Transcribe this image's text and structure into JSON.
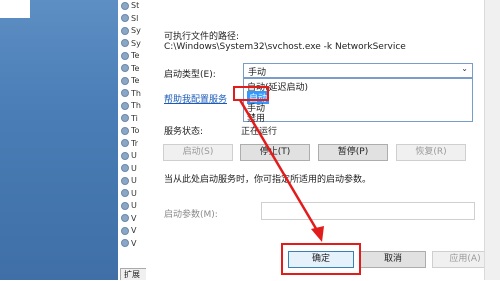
{
  "services_list": {
    "items": [
      "St",
      "Sl",
      "Sy",
      "Sy",
      "Te",
      "Te",
      "Te",
      "Th",
      "Th",
      "Ti",
      "To",
      "Tr",
      "U",
      "U",
      "U",
      "U",
      "U",
      "V",
      "V",
      "V"
    ],
    "tab": "扩展"
  },
  "dialog": {
    "exe_path_label": "可执行文件的路径:",
    "exe_path_value": "C:\\Windows\\System32\\svchost.exe -k NetworkService",
    "startup_type_label": "启动类型(E):",
    "startup_type_value": "手动",
    "dropdown_options": [
      "自动(延迟启动)",
      "自动",
      "手动",
      "禁用"
    ],
    "help_link": "帮助我配置服务",
    "service_status_label": "服务状态:",
    "service_status_value": "正在运行",
    "buttons": {
      "start": "启动(S)",
      "stop": "停止(T)",
      "pause": "暂停(P)",
      "resume": "恢复(R)"
    },
    "hint_text": "当从此处启动服务时，你可指定所适用的启动参数。",
    "start_params_label": "启动参数(M):",
    "footer": {
      "ok": "确定",
      "cancel": "取消",
      "apply": "应用(A)"
    }
  },
  "colors": {
    "highlight": "#3399ff",
    "annotation_red": "#e21b1b"
  }
}
